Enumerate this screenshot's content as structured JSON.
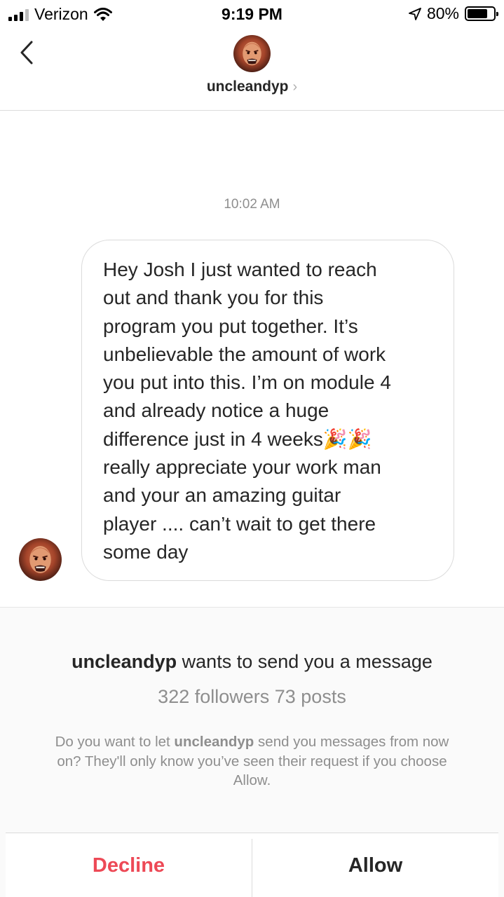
{
  "status_bar": {
    "carrier": "Verizon",
    "time": "9:19 PM",
    "battery_percent": "80%",
    "battery_level": 0.8,
    "icons": [
      "signal-icon",
      "wifi-icon",
      "location-arrow-icon",
      "battery-icon"
    ]
  },
  "header": {
    "username": "uncleandyp",
    "chevron": "›",
    "icons": [
      "back-chevron-icon",
      "avatar"
    ]
  },
  "thread": {
    "timestamp": "10:02 AM",
    "message": "Hey Josh I just wanted to reach\nout and thank you for this\nprogram you put together. It’s\nunbelievable the amount of work\nyou put into this. I’m on module 4\nand already notice a huge\ndifference just in 4 weeks🎉🎉\nreally appreciate your work man\nand your an amazing guitar\nplayer .... can’t wait to get there\nsome day"
  },
  "request": {
    "username": "uncleandyp",
    "title_suffix": " wants to send you a message",
    "stats": "322 followers 73 posts",
    "desc_prefix": "Do you want to let ",
    "desc_username": "uncleandyp",
    "desc_suffix": " send you messages from now on? They'll only know you’ve seen their request if you choose Allow.",
    "decline_label": "Decline",
    "allow_label": "Allow"
  },
  "colors": {
    "decline": "#ed4956",
    "secondary_text": "#8e8e8e",
    "primary_text": "#262626"
  }
}
